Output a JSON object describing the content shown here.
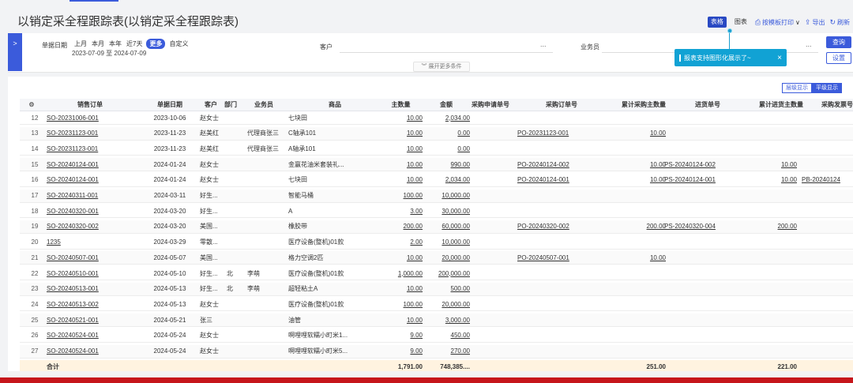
{
  "page": {
    "title": "以销定采全程跟踪表(以销定采全程跟踪表)"
  },
  "toolbar": {
    "table_label": "表格",
    "chart_label": "图表",
    "print_label": "按模板打印",
    "export_label": "导出",
    "refresh_label": "刷新"
  },
  "filters": {
    "date_label": "单据日期",
    "date_options": [
      "上月",
      "本月",
      "本年",
      "近7天",
      "更多",
      "自定义"
    ],
    "date_range": "2023-07-09 至 2024-07-09",
    "customer_label": "客户",
    "salesperson_label": "业务员",
    "ellipsis": "...",
    "expand_more": "展开更多条件",
    "query_button": "查询",
    "settings_button": "设置"
  },
  "tooltip": {
    "text": "报表支持图形化展示了~",
    "close": "×"
  },
  "view_switch": {
    "advanced": "层级显示",
    "flat": "平级显示"
  },
  "colors": {
    "accent": "#3b5bdb",
    "tooltip": "#11a2d4",
    "footer_bg": "#fff3e0",
    "bottom_bar": "#c6161b"
  },
  "table": {
    "columns": [
      "⚙",
      "销售订单",
      "单据日期",
      "客户",
      "部门",
      "业务员",
      "商品",
      "主数量",
      "金额",
      "采购申请单号",
      "采购订单号",
      "累计采购主数量",
      "进货单号",
      "累计进货主数量",
      "采购发票号"
    ],
    "rows": [
      [
        "12",
        "SO-20231006-001",
        "2023-10-06",
        "赵女士",
        "",
        "",
        "七块田",
        "10.00",
        "2,034.00",
        "",
        "",
        "",
        "",
        "",
        ""
      ],
      [
        "13",
        "SO-20231123-001",
        "2023-11-23",
        "赵美红",
        "",
        "代理商张三",
        "C轴承101",
        "10.00",
        "0.00",
        "",
        "PO-20231123-001",
        "10.00",
        "",
        "",
        ""
      ],
      [
        "14",
        "SO-20231123-001",
        "2023-11-23",
        "赵美红",
        "",
        "代理商张三",
        "A轴承101",
        "10.00",
        "0.00",
        "",
        "",
        "",
        "",
        "",
        ""
      ],
      [
        "15",
        "SO-20240124-001",
        "2024-01-24",
        "赵女士",
        "",
        "",
        "金赢花油米套装礼...",
        "10.00",
        "990.00",
        "",
        "PO-20240124-002",
        "10.00",
        "PS-20240124-002",
        "10.00",
        ""
      ],
      [
        "16",
        "SO-20240124-001",
        "2024-01-24",
        "赵女士",
        "",
        "",
        "七块田",
        "10.00",
        "2,034.00",
        "",
        "PO-20240124-001",
        "10.00",
        "PS-20240124-001",
        "10.00",
        "PB-20240124"
      ],
      [
        "17",
        "SO-20240311-001",
        "2024-03-11",
        "好生...",
        "",
        "",
        "智能马桶",
        "100.00",
        "10,000.00",
        "",
        "",
        "",
        "",
        "",
        ""
      ],
      [
        "18",
        "SO-20240320-001",
        "2024-03-20",
        "好生...",
        "",
        "",
        "A",
        "3.00",
        "30,000.00",
        "",
        "",
        "",
        "",
        "",
        ""
      ],
      [
        "19",
        "SO-20240320-002",
        "2024-03-20",
        "美国...",
        "",
        "",
        "橡胶带",
        "200.00",
        "60,000.00",
        "",
        "PO-20240320-002",
        "200.00",
        "PS-20240320-004",
        "200.00",
        ""
      ],
      [
        "20",
        "1235",
        "2024-03-29",
        "零散...",
        "",
        "",
        "医疗设备(整机)01款",
        "2.00",
        "10,000.00",
        "",
        "",
        "",
        "",
        "",
        ""
      ],
      [
        "21",
        "SO-20240507-001",
        "2024-05-07",
        "美国...",
        "",
        "",
        "格力空调2匹",
        "10.00",
        "20,000.00",
        "",
        "PO-20240507-001",
        "10.00",
        "",
        "",
        ""
      ],
      [
        "22",
        "SO-20240510-001",
        "2024-05-10",
        "好生...",
        "北",
        "李萌",
        "医疗设备(整机)01款",
        "1,000.00",
        "200,000.00",
        "",
        "",
        "",
        "",
        "",
        ""
      ],
      [
        "23",
        "SO-20240513-001",
        "2024-05-13",
        "好生...",
        "北",
        "李萌",
        "超轻粘土A",
        "10.00",
        "500.00",
        "",
        "",
        "",
        "",
        "",
        ""
      ],
      [
        "24",
        "SO-20240513-002",
        "2024-05-13",
        "赵女士",
        "",
        "",
        "医疗设备(整机)01款",
        "100.00",
        "20,000.00",
        "",
        "",
        "",
        "",
        "",
        ""
      ],
      [
        "25",
        "SO-20240521-001",
        "2024-05-21",
        "张三",
        "",
        "",
        "油管",
        "10.00",
        "3,000.00",
        "",
        "",
        "",
        "",
        "",
        ""
      ],
      [
        "26",
        "SO-20240524-001",
        "2024-05-24",
        "赵女士",
        "",
        "",
        "啊哩哩软糯小町米1...",
        "9.00",
        "450.00",
        "",
        "",
        "",
        "",
        "",
        ""
      ],
      [
        "27",
        "SO-20240524-001",
        "2024-05-24",
        "赵女士",
        "",
        "",
        "啊哩哩软糯小町米5...",
        "9.00",
        "270.00",
        "",
        "",
        "",
        "",
        "",
        ""
      ]
    ],
    "footer": {
      "label": "合计",
      "qty": "1,791.00",
      "amount": "748,385....",
      "purchase_qty": "251.00",
      "receipt_qty": "221.00"
    }
  }
}
